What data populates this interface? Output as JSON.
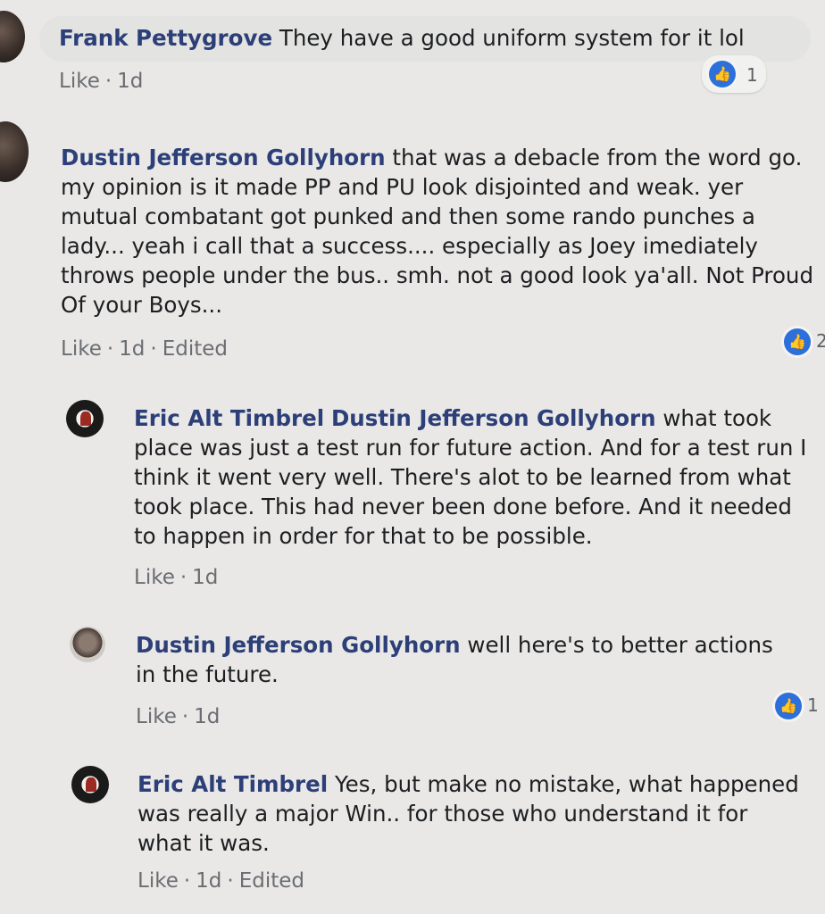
{
  "comments": [
    {
      "name": "Frank Pettygrove",
      "text": "They have a good uniform system for it lol",
      "like": "Like",
      "time": "1d",
      "edited": "",
      "reactions": "1"
    },
    {
      "name": "Dustin Jefferson Gollyhorn",
      "text": "that was a debacle from the word go. my opinion is it made PP and PU look disjointed and weak. yer mutual combatant got punked and then some rando punches a lady... yeah i call that a success.... especially as Joey imediately throws people under the bus.. smh. not a good look ya'all. Not Proud Of your Boys...",
      "like": "Like",
      "time": "1d",
      "edited": "Edited",
      "reactions": "2"
    },
    {
      "name": "Eric Alt Timbrel",
      "mention": "Dustin Jefferson Gollyhorn",
      "text": "what took place was just a test run for future action. And for a test run I think it went very well. There's alot to be learned from what took place. This had never been done before. And it needed to happen in order for that to be possible.",
      "like": "Like",
      "time": "1d"
    },
    {
      "name": "Dustin Jefferson Gollyhorn",
      "text": "well here's to better actions in the future.",
      "like": "Like",
      "time": "1d",
      "reactions": "1"
    },
    {
      "name": "Eric Alt Timbrel",
      "text": "Yes, but make no mistake, what happened was really a major Win.. for those who understand it for what it was.",
      "like": "Like",
      "time": "1d",
      "edited": "Edited"
    }
  ],
  "icons": {
    "like": "thumbs-up-icon",
    "like_color": "#2d6fdb",
    "name_color": "#2c3f78"
  },
  "separator": "·"
}
